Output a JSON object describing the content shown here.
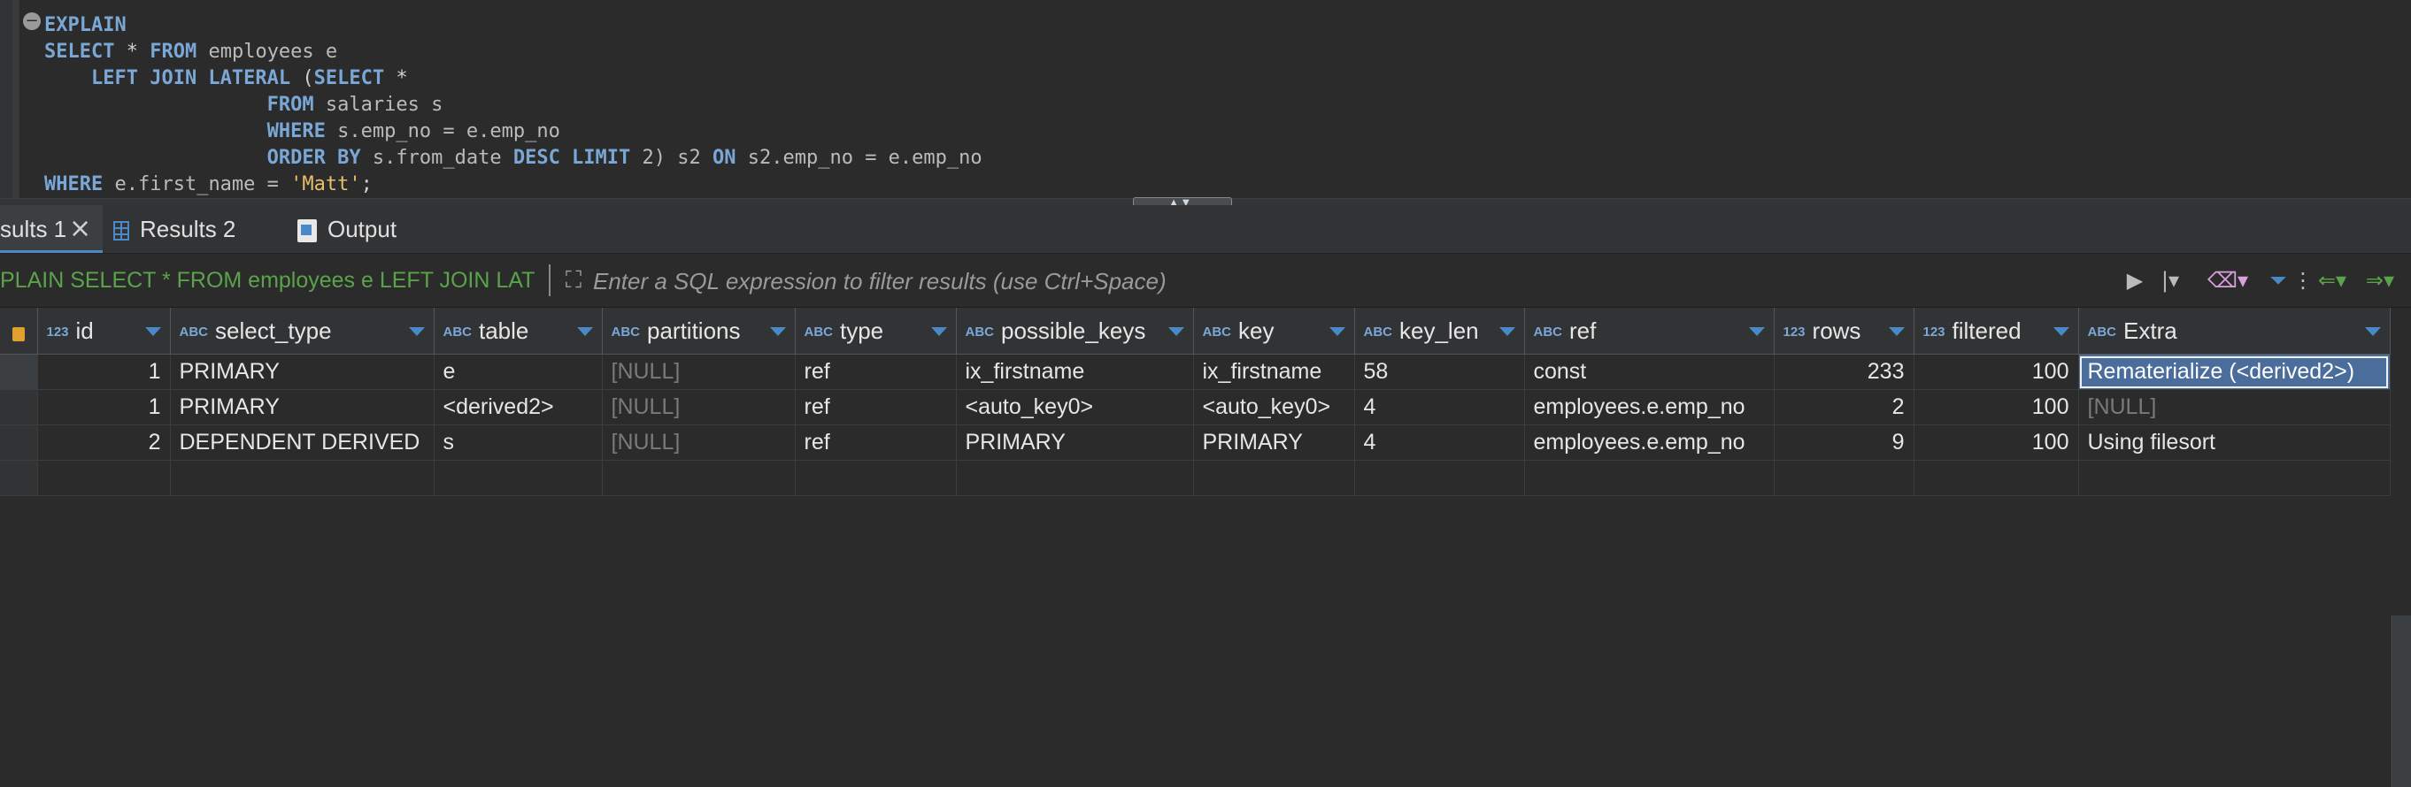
{
  "editor": {
    "fold_icon": "minus-circle-icon",
    "lines": [
      [
        {
          "t": "EXPLAIN",
          "c": "kw"
        }
      ],
      [
        {
          "t": "SELECT",
          "c": "kw"
        },
        {
          "t": " * ",
          "c": "op"
        },
        {
          "t": "FROM",
          "c": "kw"
        },
        {
          "t": " employees e",
          "c": "plain"
        }
      ],
      [
        {
          "t": "    ",
          "c": "plain"
        },
        {
          "t": "LEFT JOIN LATERAL",
          "c": "kw"
        },
        {
          "t": " (",
          "c": "op"
        },
        {
          "t": "SELECT",
          "c": "kw"
        },
        {
          "t": " *",
          "c": "op"
        }
      ],
      [
        {
          "t": "                   ",
          "c": "plain"
        },
        {
          "t": "FROM",
          "c": "kw"
        },
        {
          "t": " salaries s",
          "c": "plain"
        }
      ],
      [
        {
          "t": "                   ",
          "c": "plain"
        },
        {
          "t": "WHERE",
          "c": "kw"
        },
        {
          "t": " s.emp_no = e.emp_no",
          "c": "plain"
        }
      ],
      [
        {
          "t": "                   ",
          "c": "plain"
        },
        {
          "t": "ORDER BY",
          "c": "kw"
        },
        {
          "t": " s.from_date ",
          "c": "plain"
        },
        {
          "t": "DESC LIMIT",
          "c": "kw"
        },
        {
          "t": " 2) s2 ",
          "c": "plain"
        },
        {
          "t": "ON",
          "c": "kw"
        },
        {
          "t": " s2.emp_no = e.emp_no",
          "c": "plain"
        }
      ],
      [
        {
          "t": "WHERE",
          "c": "kw"
        },
        {
          "t": " e.first_name = ",
          "c": "plain"
        },
        {
          "t": "'Matt'",
          "c": "str"
        },
        {
          "t": ";",
          "c": "op"
        }
      ]
    ]
  },
  "tabs": {
    "results1": "sults 1",
    "results2": "Results 2",
    "output": "Output"
  },
  "filter": {
    "query_preview": "PLAIN SELECT * FROM employees e LEFT JOIN LAT",
    "placeholder": "Enter a SQL expression to filter results (use Ctrl+Space)"
  },
  "table": {
    "columns": [
      {
        "type": "123",
        "name": "id"
      },
      {
        "type": "ABC",
        "name": "select_type"
      },
      {
        "type": "ABC",
        "name": "table"
      },
      {
        "type": "ABC",
        "name": "partitions"
      },
      {
        "type": "ABC",
        "name": "type"
      },
      {
        "type": "ABC",
        "name": "possible_keys"
      },
      {
        "type": "ABC",
        "name": "key"
      },
      {
        "type": "ABC",
        "name": "key_len"
      },
      {
        "type": "ABC",
        "name": "ref"
      },
      {
        "type": "123",
        "name": "rows"
      },
      {
        "type": "123",
        "name": "filtered"
      },
      {
        "type": "ABC",
        "name": "Extra"
      }
    ],
    "rows": [
      [
        "1",
        "PRIMARY",
        "e",
        "[NULL]",
        "ref",
        "ix_firstname",
        "ix_firstname",
        "58",
        "const",
        "233",
        "100",
        "Rematerialize (<derived2>)"
      ],
      [
        "1",
        "PRIMARY",
        "<derived2>",
        "[NULL]",
        "ref",
        "<auto_key0>",
        "<auto_key0>",
        "4",
        "employees.e.emp_no",
        "2",
        "100",
        "[NULL]"
      ],
      [
        "2",
        "DEPENDENT DERIVED",
        "s",
        "[NULL]",
        "ref",
        "PRIMARY",
        "PRIMARY",
        "4",
        "employees.e.emp_no",
        "9",
        "100",
        "Using filesort"
      ]
    ]
  },
  "colors": {
    "keyword": "#7aa7d6",
    "string": "#e8bf6a",
    "query_preview": "#5aa34a",
    "accent": "#4a88c7",
    "null_text": "#7a7a7a"
  }
}
